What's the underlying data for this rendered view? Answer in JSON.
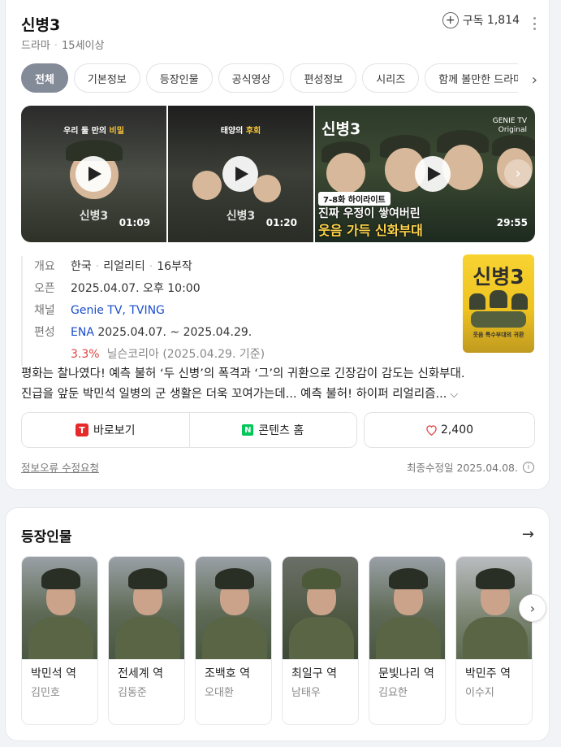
{
  "header": {
    "title": "신병3",
    "genre": "드라마",
    "rating": "15세이상",
    "subscribe_label": "구독",
    "subscribe_count": "1,814"
  },
  "tabs": [
    "전체",
    "기본정보",
    "등장인물",
    "공식영상",
    "편성정보",
    "시리즈",
    "함께 볼만한 드라마"
  ],
  "videos": [
    {
      "caption_a": "우리 둘 만의 ",
      "caption_b": "비밀",
      "duration": "01:09",
      "logo": "신병3"
    },
    {
      "caption_a": "태양의 ",
      "caption_b": "후회",
      "duration": "01:20",
      "logo": "신병3"
    },
    {
      "title": "신병3",
      "brand_a": "GENIE TV",
      "brand_b": "Original",
      "tag": "7-8화 하이라이트",
      "headline_1": "진짜 우정이 쌓여버린",
      "headline_2": "웃음 가득 신화부대",
      "duration": "29:55"
    }
  ],
  "info": {
    "overview_label": "개요",
    "overview": [
      "한국",
      "리얼리티",
      "16부작"
    ],
    "open_label": "오픈",
    "open": "2025.04.07. 오후 10:00",
    "channel_label": "채널",
    "channels": [
      "Genie TV",
      "TVING"
    ],
    "schedule_label": "편성",
    "schedule_channel": "ENA",
    "schedule_dates": "2025.04.07. ~ 2025.04.29.",
    "ratings_value": "3.3%",
    "ratings_source": "닐슨코리아",
    "ratings_basis": "(2025.04.29. 기준)",
    "poster_title": "신병3",
    "poster_subtitle": "웃음 특수부대의 귀환"
  },
  "description": {
    "line1": "평화는 찰나였다! 예측 불허 ‘두 신병’의 폭격과 ‘그’의 귀환으로 긴장감이 감도는 신화부대.",
    "line2": "진급을 앞둔 박민석 일병의 군 생활은 더욱 꼬여가는데... 예측 불허! 하이퍼 리얼리즘..."
  },
  "actions": {
    "watch": "바로보기",
    "content_home": "콘텐츠 홈",
    "likes": "2,400"
  },
  "footer": {
    "report": "정보오류 수정요청",
    "updated": "최종수정일 2025.04.08."
  },
  "cast_section": {
    "title": "등장인물",
    "people": [
      {
        "role": "박민석 역",
        "actor": "김민호"
      },
      {
        "role": "전세계 역",
        "actor": "김동준"
      },
      {
        "role": "조백호 역",
        "actor": "오대환"
      },
      {
        "role": "최일구 역",
        "actor": "남태우"
      },
      {
        "role": "문빛나리 역",
        "actor": "김요한"
      },
      {
        "role": "박민주 역",
        "actor": "이수지"
      }
    ]
  },
  "colors": {
    "accent_link": "#1a4dcc",
    "ratings_red": "#e14343",
    "active_tab": "#838a98",
    "naver_green": "#03c75a",
    "tv_red": "#e62a2a"
  }
}
